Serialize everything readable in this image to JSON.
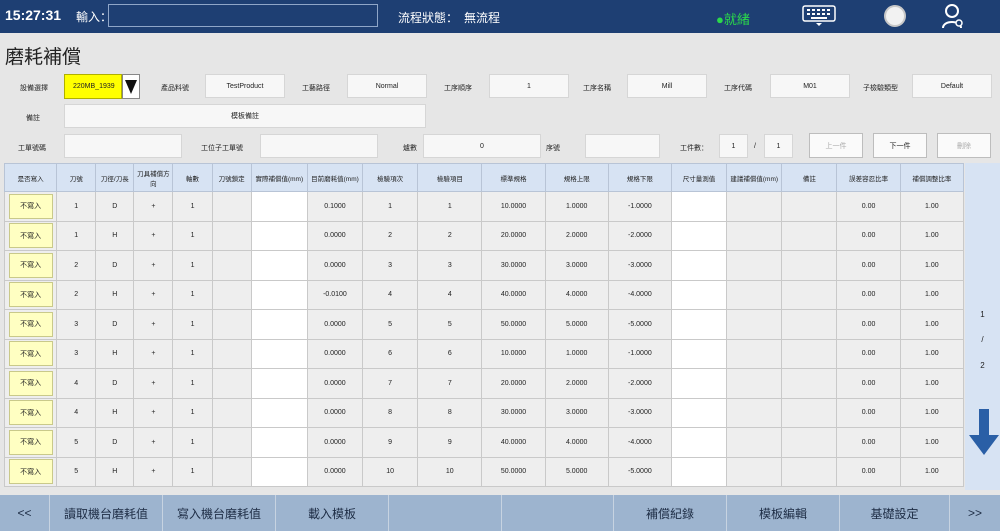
{
  "topbar": {
    "time": "15:27:31",
    "input_label": "輸入：",
    "input_value": "",
    "flow_label": "流程狀態：",
    "flow_value": "無流程",
    "status": "●就緒",
    "status_color": "#2bd94a",
    "icons": [
      "keyboard-icon",
      "circle-button-icon",
      "user-icon"
    ]
  },
  "page_title": "磨耗補償",
  "form": {
    "equipment_label": "設備選擇",
    "equipment_value": "220MB_1939",
    "product_label": "產品料號",
    "product_value": "TestProduct",
    "path_label": "工藝路徑",
    "path_value": "Normal",
    "proc_order_label": "工序順序",
    "proc_order_value": "1",
    "proc_name_label": "工序名稱",
    "proc_name_value": "Mill",
    "proc_code_label": "工序代碼",
    "proc_code_value": "M01",
    "sub_type_label": "子檢驗類型",
    "sub_type_value": "Default",
    "note_label": "備註",
    "note_value": "模板備註",
    "order_label": "工單號碼",
    "order_value": "",
    "sub_order_label": "工位子工單號",
    "sub_order_value": "",
    "lot_label": "爐數",
    "lot_value": "0",
    "seq_label": "序號",
    "seq_value": "",
    "work_count_label": "工件數：",
    "work_current": "1",
    "work_sep": "/",
    "work_total": "1",
    "prev_label": "上一件",
    "next_label": "下一件",
    "delete_label": "刪除"
  },
  "table": {
    "headers": [
      "是否寫入",
      "刀號",
      "刀徑/刀長",
      "刀具補償方向",
      "軸數",
      "刀號鎖定",
      "實際補償值(mm)",
      "目前磨耗值(mm)",
      "檢驗項次",
      "檢驗項目",
      "標準規格",
      "規格上限",
      "規格下限",
      "尺寸量測值",
      "建議補償值(mm)",
      "備註",
      "誤差容忍比率",
      "補償調整比率"
    ],
    "rows": [
      {
        "write": "不寫入",
        "tool": "1",
        "type": "D",
        "dir": "+",
        "axis": "1",
        "lock": "",
        "actual": "",
        "wear": "0.1000",
        "item_no": "1",
        "item": "1",
        "std": "10.0000",
        "upper": "1.0000",
        "lower": "-1.0000",
        "measure": "",
        "suggest": "",
        "note": "",
        "tol": "0.00",
        "adj": "1.00"
      },
      {
        "write": "不寫入",
        "tool": "1",
        "type": "H",
        "dir": "+",
        "axis": "1",
        "lock": "",
        "actual": "",
        "wear": "0.0000",
        "item_no": "2",
        "item": "2",
        "std": "20.0000",
        "upper": "2.0000",
        "lower": "-2.0000",
        "measure": "",
        "suggest": "",
        "note": "",
        "tol": "0.00",
        "adj": "1.00"
      },
      {
        "write": "不寫入",
        "tool": "2",
        "type": "D",
        "dir": "+",
        "axis": "1",
        "lock": "",
        "actual": "",
        "wear": "0.0000",
        "item_no": "3",
        "item": "3",
        "std": "30.0000",
        "upper": "3.0000",
        "lower": "-3.0000",
        "measure": "",
        "suggest": "",
        "note": "",
        "tol": "0.00",
        "adj": "1.00"
      },
      {
        "write": "不寫入",
        "tool": "2",
        "type": "H",
        "dir": "+",
        "axis": "1",
        "lock": "",
        "actual": "",
        "wear": "-0.0100",
        "item_no": "4",
        "item": "4",
        "std": "40.0000",
        "upper": "4.0000",
        "lower": "-4.0000",
        "measure": "",
        "suggest": "",
        "note": "",
        "tol": "0.00",
        "adj": "1.00"
      },
      {
        "write": "不寫入",
        "tool": "3",
        "type": "D",
        "dir": "+",
        "axis": "1",
        "lock": "",
        "actual": "",
        "wear": "0.0000",
        "item_no": "5",
        "item": "5",
        "std": "50.0000",
        "upper": "5.0000",
        "lower": "-5.0000",
        "measure": "",
        "suggest": "",
        "note": "",
        "tol": "0.00",
        "adj": "1.00"
      },
      {
        "write": "不寫入",
        "tool": "3",
        "type": "H",
        "dir": "+",
        "axis": "1",
        "lock": "",
        "actual": "",
        "wear": "0.0000",
        "item_no": "6",
        "item": "6",
        "std": "10.0000",
        "upper": "1.0000",
        "lower": "-1.0000",
        "measure": "",
        "suggest": "",
        "note": "",
        "tol": "0.00",
        "adj": "1.00"
      },
      {
        "write": "不寫入",
        "tool": "4",
        "type": "D",
        "dir": "+",
        "axis": "1",
        "lock": "",
        "actual": "",
        "wear": "0.0000",
        "item_no": "7",
        "item": "7",
        "std": "20.0000",
        "upper": "2.0000",
        "lower": "-2.0000",
        "measure": "",
        "suggest": "",
        "note": "",
        "tol": "0.00",
        "adj": "1.00"
      },
      {
        "write": "不寫入",
        "tool": "4",
        "type": "H",
        "dir": "+",
        "axis": "1",
        "lock": "",
        "actual": "",
        "wear": "0.0000",
        "item_no": "8",
        "item": "8",
        "std": "30.0000",
        "upper": "3.0000",
        "lower": "-3.0000",
        "measure": "",
        "suggest": "",
        "note": "",
        "tol": "0.00",
        "adj": "1.00"
      },
      {
        "write": "不寫入",
        "tool": "5",
        "type": "D",
        "dir": "+",
        "axis": "1",
        "lock": "",
        "actual": "",
        "wear": "0.0000",
        "item_no": "9",
        "item": "9",
        "std": "40.0000",
        "upper": "4.0000",
        "lower": "-4.0000",
        "measure": "",
        "suggest": "",
        "note": "",
        "tol": "0.00",
        "adj": "1.00"
      },
      {
        "write": "不寫入",
        "tool": "5",
        "type": "H",
        "dir": "+",
        "axis": "1",
        "lock": "",
        "actual": "",
        "wear": "0.0000",
        "item_no": "10",
        "item": "10",
        "std": "50.0000",
        "upper": "5.0000",
        "lower": "-5.0000",
        "measure": "",
        "suggest": "",
        "note": "",
        "tol": "0.00",
        "adj": "1.00"
      }
    ]
  },
  "pager": {
    "current": "1",
    "sep": "/",
    "total": "2"
  },
  "bottombar": {
    "prev": "<<",
    "read_wear": "讀取機台磨耗值",
    "write_wear": "寫入機台磨耗值",
    "load_template": "載入模板",
    "blank1": "",
    "blank2": "",
    "comp_record": "補償紀錄",
    "template_edit": "模板編輯",
    "basic_setting": "基礎設定",
    "next": ">>"
  }
}
